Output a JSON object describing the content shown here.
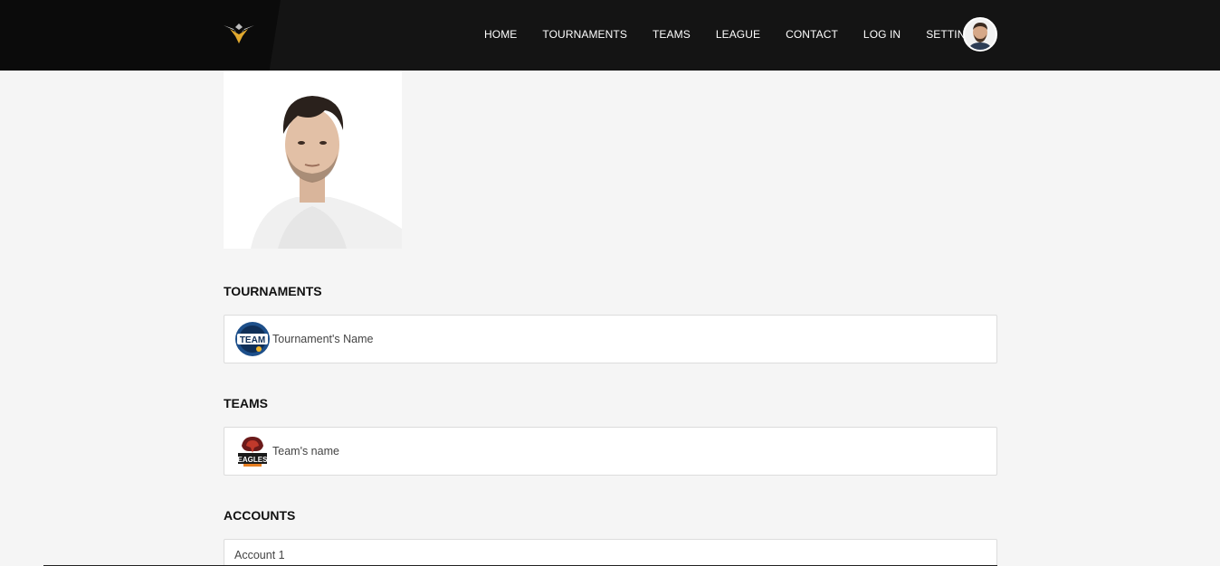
{
  "nav": {
    "items": [
      "HOME",
      "TOURNAMENTS",
      "TEAMS",
      "LEAGUE",
      "CONTACT",
      "LOG IN",
      "SETTINGS"
    ]
  },
  "sections": {
    "tournaments": {
      "title": "TOURNAMENTS",
      "badge": "TEAM",
      "item_label": "Tournament's Name"
    },
    "teams": {
      "title": "TEAMS",
      "badge": "EAGLES",
      "item_label": "Team's name"
    },
    "accounts": {
      "title": "ACCOUNTS",
      "item_label": "Account 1"
    }
  },
  "colors": {
    "header_bg": "#141414",
    "logo_accent": "#e0a82e",
    "page_bg": "#f5f5f5"
  }
}
